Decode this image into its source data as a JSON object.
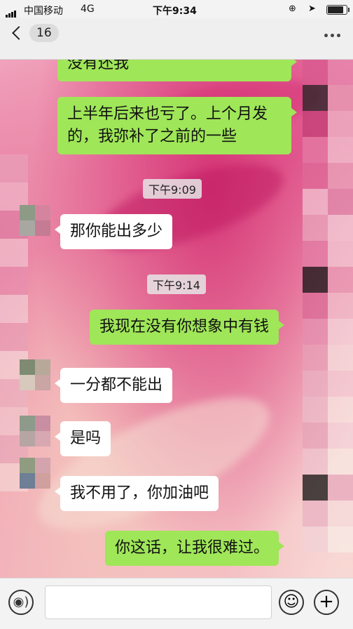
{
  "status_bar": {
    "carrier": "中国移动",
    "network": "4G",
    "time": "下午9:34"
  },
  "nav": {
    "back_count": "16"
  },
  "messages": [
    {
      "side": "right",
      "text": "没有还我"
    },
    {
      "side": "right",
      "text": "上半年后来也亏了。上个月发的，我弥补了之前的一些"
    },
    {
      "type": "time",
      "text": "下午9:09"
    },
    {
      "side": "left",
      "text": "那你能出多少"
    },
    {
      "type": "time",
      "text": "下午9:14"
    },
    {
      "side": "right",
      "text": "我现在没有你想象中有钱"
    },
    {
      "side": "left",
      "text": "一分都不能出"
    },
    {
      "side": "left",
      "text": "是吗"
    },
    {
      "side": "left",
      "text": "我不用了，你加油吧"
    },
    {
      "side": "right",
      "text": "你这话，让我很难过。"
    }
  ],
  "input_bar": {
    "voice_icon": "voice-icon",
    "emoji_icon": "emoji-icon",
    "plus_icon": "plus-icon"
  },
  "colors": {
    "outgoing_bubble": "#9fe658",
    "incoming_bubble": "#ffffff"
  }
}
